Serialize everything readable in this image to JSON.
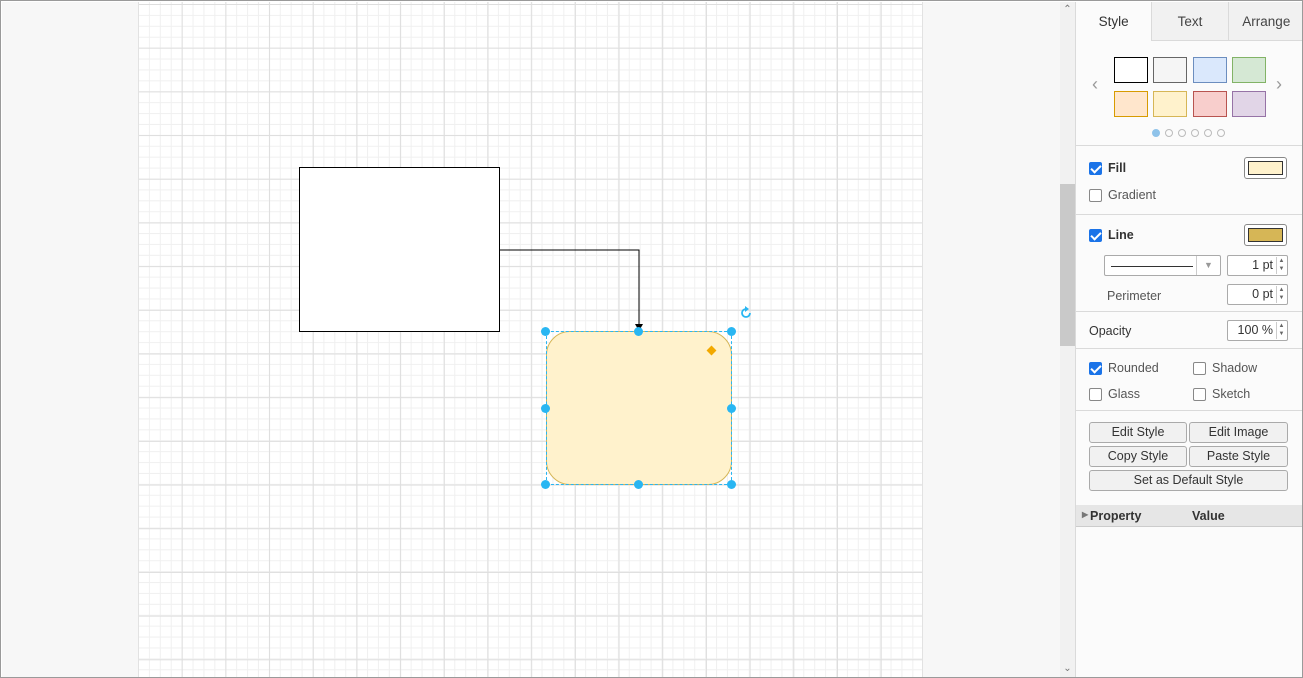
{
  "canvas": {
    "shapes": [
      {
        "name": "rectangle",
        "fill": "#ffffff",
        "stroke": "#000000"
      },
      {
        "name": "rounded-rectangle",
        "fill": "#fff2cc",
        "stroke": "#d6b656",
        "selected": true
      }
    ],
    "selection_color": "#29b6f2"
  },
  "tabs": [
    "Style",
    "Text",
    "Arrange"
  ],
  "active_tab": "Style",
  "swatch_colors": [
    "#ffffff",
    "#f5f5f5",
    "#dae8fc",
    "#d5e8d4",
    "#ffe6cc",
    "#fff2cc",
    "#f8cecc",
    "#e1d5e7"
  ],
  "swatch_pages": 6,
  "fill": {
    "label": "Fill",
    "checked": true,
    "color": "#fff2cc"
  },
  "gradient": {
    "label": "Gradient",
    "checked": false
  },
  "line": {
    "label": "Line",
    "checked": true,
    "color": "#d6b656",
    "width": "1 pt"
  },
  "perimeter": {
    "label": "Perimeter",
    "value": "0 pt"
  },
  "opacity": {
    "label": "Opacity",
    "value": "100 %"
  },
  "options": {
    "rounded": {
      "label": "Rounded",
      "checked": true
    },
    "shadow": {
      "label": "Shadow",
      "checked": false
    },
    "glass": {
      "label": "Glass",
      "checked": false
    },
    "sketch": {
      "label": "Sketch",
      "checked": false
    }
  },
  "buttons": {
    "edit_style": "Edit Style",
    "edit_image": "Edit Image",
    "copy_style": "Copy Style",
    "paste_style": "Paste Style",
    "set_default": "Set as Default Style"
  },
  "property_table": {
    "col1": "Property",
    "col2": "Value"
  }
}
